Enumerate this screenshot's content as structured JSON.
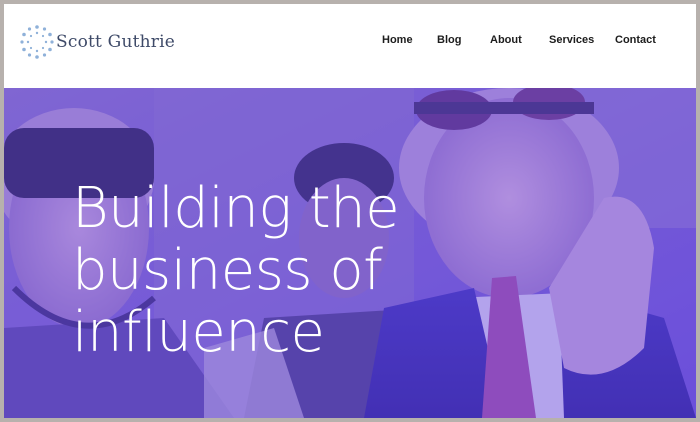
{
  "brand": {
    "name": "Scott Guthrie"
  },
  "nav": {
    "items": [
      {
        "label": "Home"
      },
      {
        "label": "Blog"
      },
      {
        "label": "About"
      },
      {
        "label": "Services"
      },
      {
        "label": "Contact"
      }
    ]
  },
  "hero": {
    "title_lines": [
      "Building the",
      "business of",
      "influence"
    ]
  },
  "colors": {
    "overlay": "#6e50e6",
    "brand_text": "#3e4a68",
    "logo_dots": "#8fb1d9"
  }
}
